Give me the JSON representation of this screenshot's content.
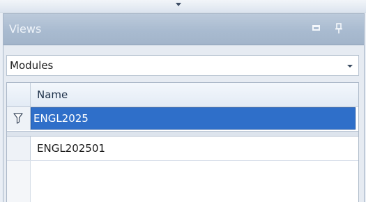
{
  "panel": {
    "title": "Views"
  },
  "view_selector": {
    "selected": "Modules"
  },
  "grid": {
    "columns": [
      "Name"
    ],
    "filter_value": "ENGL2025",
    "rows": [
      {
        "name": "ENGL202501"
      }
    ]
  },
  "colors": {
    "header_bg": "#a9bbd0",
    "selection_bg": "#2f6fc9",
    "panel_bg": "#e6ebf2"
  },
  "icons": {
    "maximize": "maximize-icon",
    "pin": "pin-icon",
    "filter": "filter-icon",
    "dropdown": "chevron-down-icon"
  }
}
